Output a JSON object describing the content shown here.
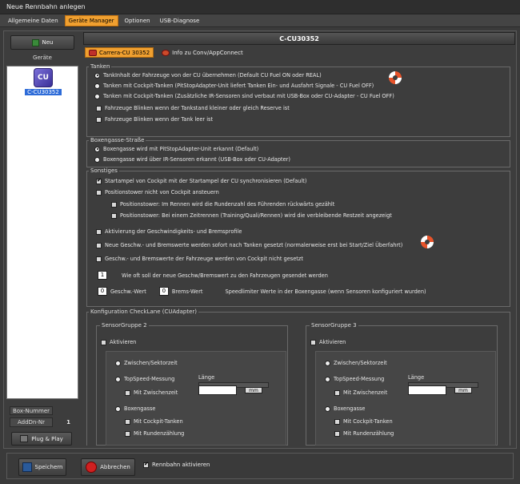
{
  "window": {
    "title": "Neue Rennbahn anlegen"
  },
  "menu": [
    "Allgemeine Daten",
    "Geräte Manager",
    "Optionen",
    "USB-Diagnose"
  ],
  "left": {
    "new_label": "Neu",
    "devices_header": "Geräte",
    "device_name": "C-CU30352",
    "device_icon_text": "CU",
    "box_number_label": "Box-Nummer",
    "addr_label": "AddDn-Nr",
    "addr_value": "1",
    "plug_label": "Plug & Play"
  },
  "main": {
    "header": "C-CU30352",
    "tab_active": "Carrera-CU 30352",
    "tab_info": "Info zu Conv/AppConnect",
    "tanken": {
      "legend": "Tanken",
      "opt1": "TankInhalt der Fahrzeuge von der CU übernehmen (Default CU Fuel ON oder REAL)",
      "opt2": "Tanken mit Cockpit-Tanken (PitStopAdapter-Unit liefert Tanken Ein- und Ausfahrt Signale - CU Fuel OFF)",
      "opt3": "Tanken mit Cockpit-Tanken (Zusätzliche IR-Sensoren sind verbaut mit USB-Box oder CU-Adapter - CU Fuel OFF)",
      "cb1": "Fahrzeuge Blinken wenn der Tankstand kleiner oder gleich Reserve ist",
      "cb2": "Fahrzeuge Blinken wenn der Tank leer ist"
    },
    "boxen": {
      "legend": "Boxengasse-Straße",
      "opt1": "Boxengasse wird mit PitStopAdapter-Unit erkannt (Default)",
      "opt2": "Boxengasse wird über IR-Sensoren erkannt (USB-Box oder CU-Adapter)"
    },
    "sonstiges": {
      "legend": "Sonstiges",
      "cb1": "Startampel von Cockpit mit der Startampel der CU synchronisieren (Default)",
      "cb2": "Positionstower nicht von Cockpit ansteuern",
      "cb3": "Positionstower: Im Rennen wird die Rundenzahl des Führenden rückwärts gezählt",
      "cb4": "Positionstower: Bei einem Zeitrennen (Training/Quali/Rennen) wird die verbleibende Restzeit angezeigt",
      "cb5": "Aktivierung der Geschwindigkeits- und Bremsprofile",
      "cb6": "Neue Geschw.- und Bremswerte werden sofort nach Tanken gesetzt (normalerweise erst bei Start/Ziel Überfahrt)",
      "cb7": "Geschw.- und Bremswerte der Fahrzeuge werden von Cockpit nicht gesetzt",
      "freq_value": "1",
      "freq_label": "Wie oft soll der neue Geschw/Bremswert zu den Fahrzeugen gesendet werden",
      "geschw_value": "0",
      "geschw_label": "Geschw.-Wert",
      "brems_value": "0",
      "brems_label": "Brems-Wert",
      "speedlimiter_label": "Speedlimiter Werte in der Boxengasse (wenn Sensoren konfiguriert wurden)"
    },
    "checklane": {
      "legend": "Konfiguration CheckLane (CUAdapter)",
      "groups": [
        {
          "title": "SensorGruppe 2",
          "aktivieren": "Aktivieren",
          "zwischen": "Zwischen/Sektorzeit",
          "topspeed": "TopSpeed-Messung",
          "laenge": "Länge",
          "mit_zwischen": "Mit Zwischenzeit",
          "mm": "mm",
          "boxengasse": "Boxengasse",
          "mit_cockpit": "Mit Cockpit-Tanken",
          "mit_runden": "Mit Rundenzählung"
        },
        {
          "title": "SensorGruppe 3",
          "aktivieren": "Aktivieren",
          "zwischen": "Zwischen/Sektorzeit",
          "topspeed": "TopSpeed-Messung",
          "laenge": "Länge",
          "mit_zwischen": "Mit Zwischenzeit",
          "mm": "mm",
          "boxengasse": "Boxengasse",
          "mit_cockpit": "Mit Cockpit-Tanken",
          "mit_runden": "Mit Rundenzählung"
        }
      ]
    }
  },
  "bottom": {
    "save_label": "Speichern",
    "cancel_label": "Abbrechen",
    "rennbahn_label": "Rennbahn aktivieren"
  }
}
